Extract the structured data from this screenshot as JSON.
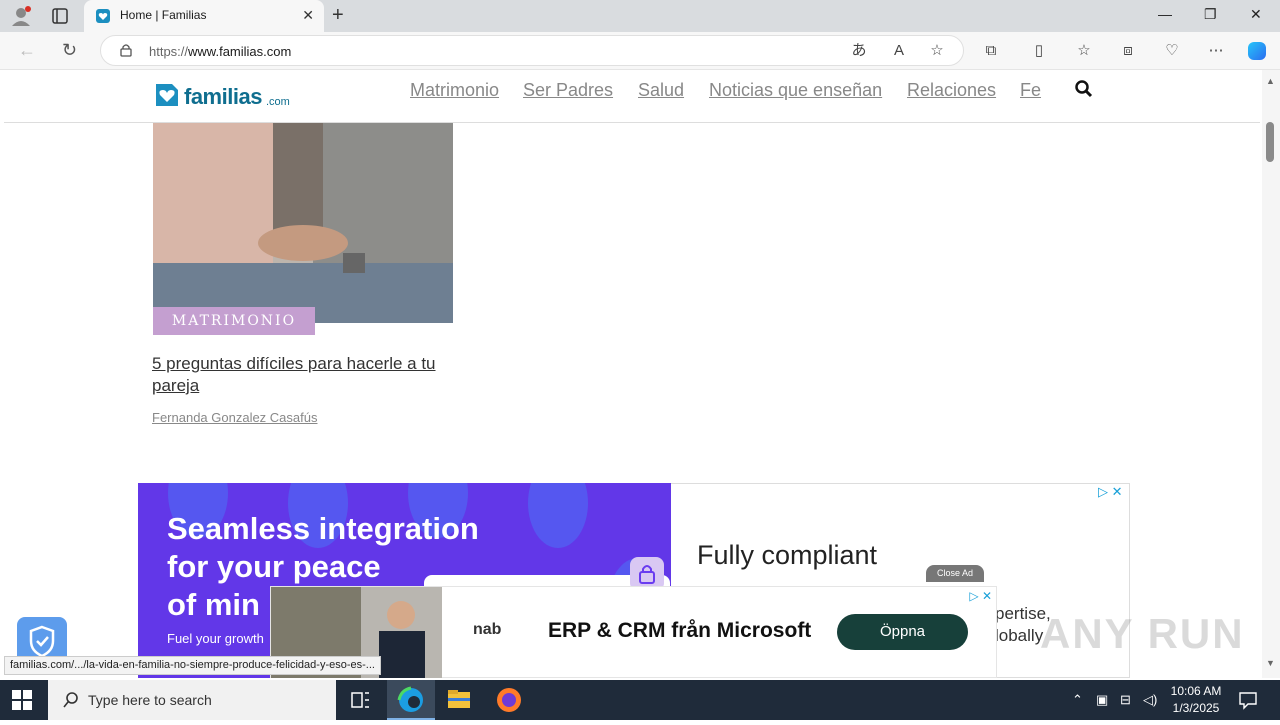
{
  "browser": {
    "tab_title": "Home | Familias",
    "url_prefix": "https://",
    "url_domain": "www.familias.com",
    "status_url": "familias.com/.../la-vida-en-familia-no-siempre-produce-felicidad-y-eso-es-..."
  },
  "site": {
    "logo_text": "familias",
    "logo_suffix": ".com",
    "brand_color": "#0f6e8f",
    "nav": [
      "Matrimonio",
      "Ser Padres",
      "Salud",
      "Noticias que enseñan",
      "Relaciones",
      "Fe"
    ]
  },
  "article": {
    "category": "MATRIMONIO",
    "title": "5 preguntas difíciles para hacerle a tu pareja",
    "author": "Fernanda Gonzalez Casafús",
    "badge_color": "#c49fd0"
  },
  "ad": {
    "line1": "Seamless integration",
    "line2": "for your peace",
    "line3": "of min",
    "small": "Fuel your growth",
    "right_head": "Fully compliant",
    "right_tail1": "pertise,",
    "right_tail2": "lobally",
    "close_ad": "Close Ad"
  },
  "overlay_ad": {
    "brand": "nab",
    "headline": "ERP & CRM från Microsoft",
    "cta": "Öppna"
  },
  "watermark": "ANY RUN",
  "taskbar": {
    "search_placeholder": "Type here to search",
    "time": "10:06 AM",
    "date": "1/3/2025"
  }
}
